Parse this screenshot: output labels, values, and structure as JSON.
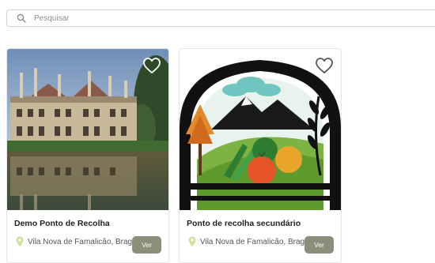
{
  "search": {
    "placeholder": "Pesquisar"
  },
  "cards": [
    {
      "title": "Demo Ponto de Recolha",
      "location": "Vila Nova de Famalicão, Braga",
      "button": "Ver"
    },
    {
      "title": "Ponto de recolha secundário",
      "location": "Vila Nova de Famalicão, Braga",
      "button": "Ver"
    }
  ],
  "colors": {
    "button": "#8a8f7a",
    "pin": "#cfe39a",
    "border": "#cfd2d6"
  },
  "icons": {
    "search": "search-icon",
    "favorite": "heart-icon",
    "location": "location-pin-icon"
  }
}
